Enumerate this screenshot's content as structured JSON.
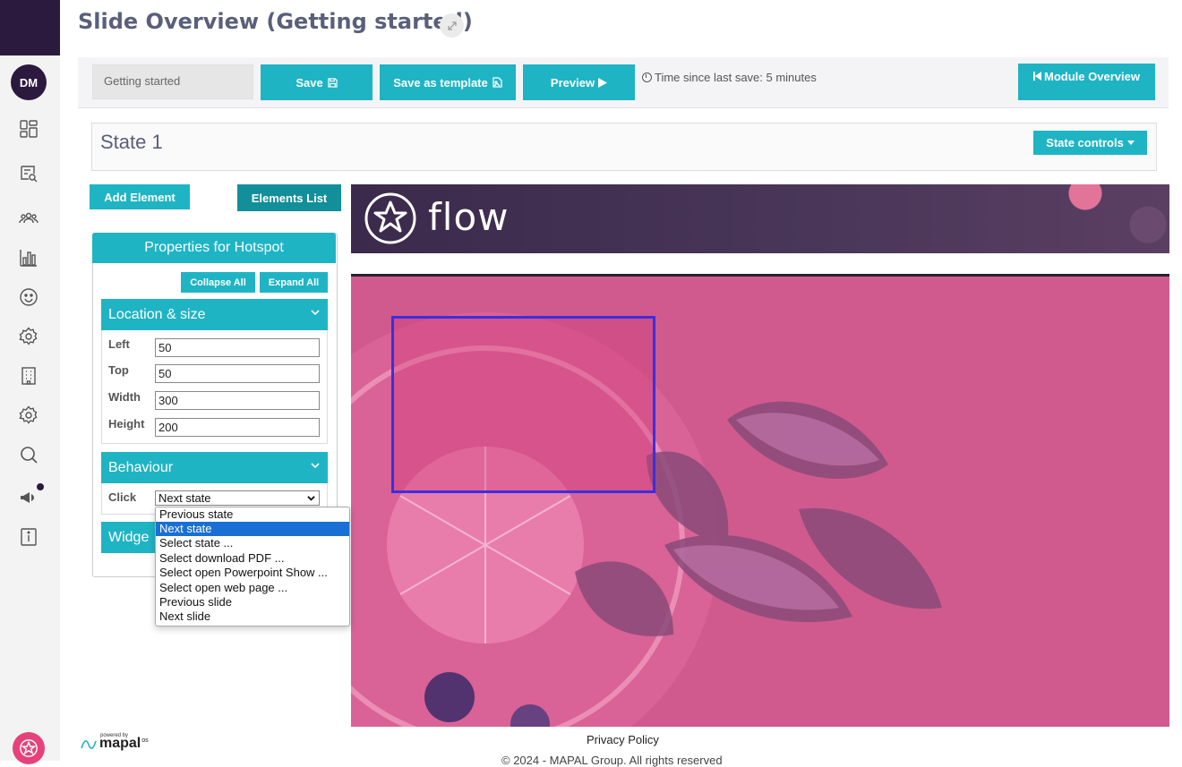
{
  "sidebar": {
    "avatar_initials": "DM",
    "icons": [
      "dashboard-icon",
      "search-list-icon",
      "users-icon",
      "chart-icon",
      "smiley-icon",
      "settings-icon",
      "building-icon",
      "settings-icon",
      "search-icon",
      "megaphone-icon",
      "info-icon"
    ]
  },
  "header": {
    "title": "Slide Overview (Getting started)"
  },
  "toolbar": {
    "module_name": "Getting started",
    "save_label": "Save",
    "save_as_template_label": "Save as template",
    "preview_label": "Preview",
    "last_save": "Time since last save: 5 minutes",
    "module_overview_label": "Module Overview"
  },
  "state": {
    "title": "State 1",
    "controls_label": "State controls"
  },
  "panel": {
    "add_element_label": "Add Element",
    "elements_list_label": "Elements List",
    "properties_title": "Properties for Hotspot",
    "collapse_all_label": "Collapse All",
    "expand_all_label": "Expand All",
    "location_section": "Location & size",
    "fields": {
      "left_label": "Left",
      "left_value": "50",
      "top_label": "Top",
      "top_value": "50",
      "width_label": "Width",
      "width_value": "300",
      "height_label": "Height",
      "height_value": "200"
    },
    "behaviour_section": "Behaviour",
    "click_label": "Click",
    "click_value": "Next state",
    "widget_section": "Widge"
  },
  "dropdown": {
    "options": [
      "Previous state",
      "Next state",
      "Select state ...",
      "Select download PDF ...",
      "Select open Powerpoint Show ...",
      "Select open web page ...",
      "Previous slide",
      "Next slide"
    ],
    "selected": "Next state"
  },
  "slide": {
    "logo_text": "flow"
  },
  "footer": {
    "powered_by": "powered by",
    "brand": "mapal",
    "brand_suffix": "os",
    "privacy_label": "Privacy Policy",
    "copyright": "© 2024 - MAPAL Group. All rights reserved"
  },
  "colors": {
    "accent": "#1fb4c4",
    "accent_dark": "#138f9a",
    "sidebar_dark": "#2b1a3e",
    "hotspot_border": "#3b2fe0",
    "slide_pink": "#d05a8e"
  }
}
